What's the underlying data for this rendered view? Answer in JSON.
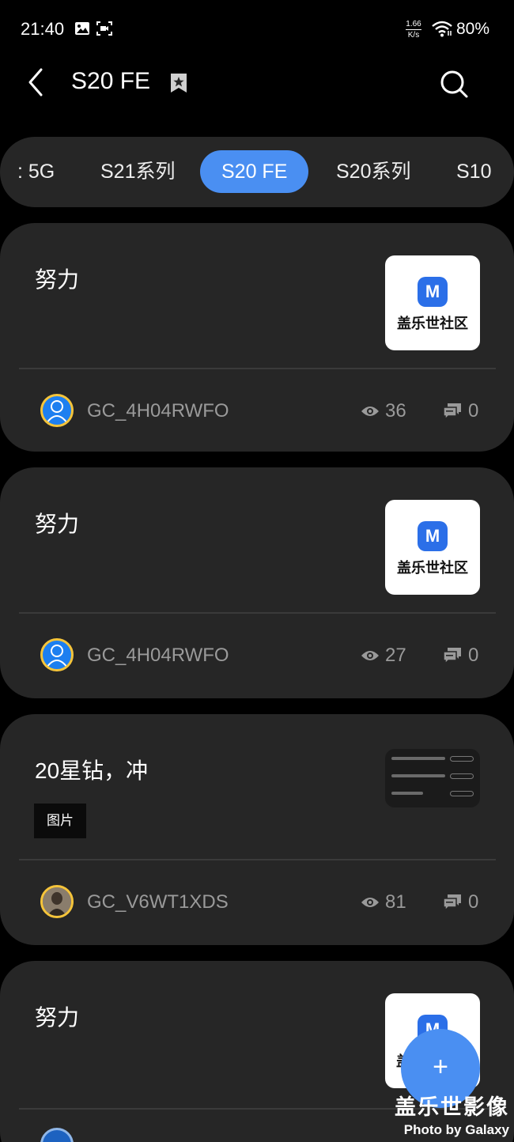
{
  "status_bar": {
    "time": "21:40",
    "net_speed_value": "1.66",
    "net_speed_unit": "K/s",
    "battery": "80%",
    "icons": [
      "image-icon",
      "screen-record-icon",
      "wifi-icon"
    ]
  },
  "header": {
    "title": "S20 FE",
    "icons": [
      "back-arrow-icon",
      "bookmark-star-icon",
      "search-icon"
    ]
  },
  "tabs": [
    {
      "label": "5G"
    },
    {
      "label": "S21系列"
    },
    {
      "label": "S20 FE",
      "active": true
    },
    {
      "label": "S20系列"
    },
    {
      "label": "S10"
    }
  ],
  "posts": [
    {
      "title": "努力",
      "thumb_text": "盖乐世社区",
      "thumb_logo": "M",
      "author": "GC_4H04RWFO",
      "views": "36",
      "comments": "0"
    },
    {
      "title": "努力",
      "thumb_text": "盖乐世社区",
      "thumb_logo": "M",
      "author": "GC_4H04RWFO",
      "views": "27",
      "comments": "0"
    },
    {
      "title": "20星钻，冲",
      "tag": "图片",
      "author": "GC_V6WT1XDS",
      "views": "81",
      "comments": "0"
    },
    {
      "title": "努力",
      "thumb_logo": "M",
      "thumb_text": "盖"
    }
  ],
  "fab": {
    "label": "+"
  },
  "watermark": {
    "line1": "盖乐世影像",
    "line2": "Photo by Galaxy"
  },
  "colors": {
    "accent": "#4a8ff2",
    "card_bg": "#262626",
    "muted_text": "#9a9a9a",
    "avatar_ring": "#f5c43a"
  }
}
